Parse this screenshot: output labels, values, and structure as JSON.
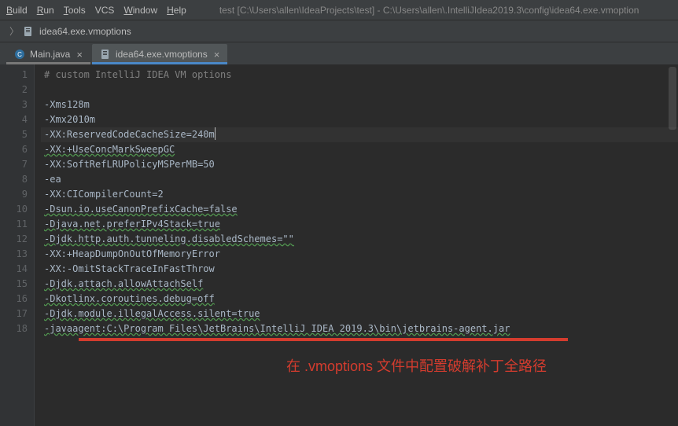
{
  "menu": {
    "build": "Build",
    "run": "Run",
    "tools": "Tools",
    "vcs": "VCS",
    "window": "Window",
    "help": "Help"
  },
  "titlebar": "test [C:\\Users\\allen\\IdeaProjects\\test] - C:\\Users\\allen\\.IntelliJIdea2019.3\\config\\idea64.exe.vmoption",
  "crumb": {
    "file": "idea64.exe.vmoptions"
  },
  "tabs": {
    "t0": "Main.java",
    "t1": "idea64.exe.vmoptions"
  },
  "lines": {
    "l1": "# custom IntelliJ IDEA VM options",
    "l2": "",
    "l3": "-Xms128m",
    "l4": "-Xmx2010m",
    "l5": "-XX:ReservedCodeCacheSize=240m",
    "l6": "-XX:+UseConcMarkSweepGC",
    "l7": "-XX:SoftRefLRUPolicyMSPerMB=50",
    "l8": "-ea",
    "l9": "-XX:CICompilerCount=2",
    "l10": "-Dsun.io.useCanonPrefixCache=false",
    "l11": "-Djava.net.preferIPv4Stack=true",
    "l12": "-Djdk.http.auth.tunneling.disabledSchemes=\"\"",
    "l13": "-XX:+HeapDumpOnOutOfMemoryError",
    "l14": "-XX:-OmitStackTraceInFastThrow",
    "l15": "-Djdk.attach.allowAttachSelf",
    "l16": "-Dkotlinx.coroutines.debug=off",
    "l17": "-Djdk.module.illegalAccess.silent=true",
    "l18": "-javaagent:C:\\Program Files\\JetBrains\\IntelliJ IDEA 2019.3\\bin\\jetbrains-agent.jar"
  },
  "lineNumbers": [
    "1",
    "2",
    "3",
    "4",
    "5",
    "6",
    "7",
    "8",
    "9",
    "10",
    "11",
    "12",
    "13",
    "14",
    "15",
    "16",
    "17",
    "18"
  ],
  "annotation": "在 .vmoptions 文件中配置破解补丁全路径",
  "colors": {
    "redbar": "#d43c2e"
  }
}
